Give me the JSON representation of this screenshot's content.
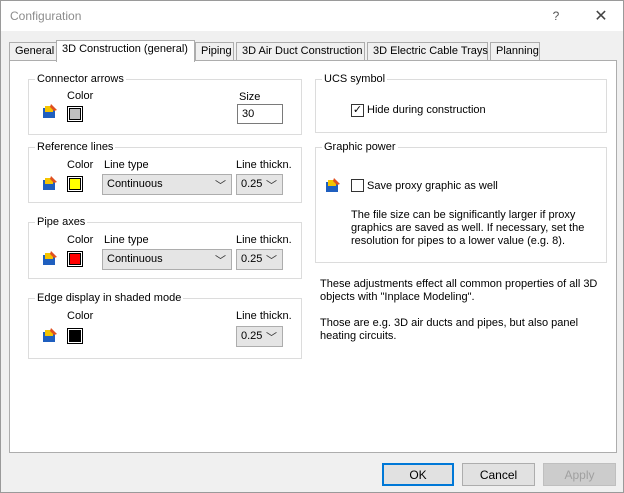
{
  "window": {
    "title": "Configuration",
    "help_glyph": "?",
    "close_glyph": "✕"
  },
  "tabs": [
    "General",
    "3D Construction (general)",
    "Piping",
    "3D Air Duct Construction",
    "3D Electric Cable Trays",
    "Planning"
  ],
  "active_tab": "3D Construction (general)",
  "connector_arrows": {
    "title": "Connector arrows",
    "color_label": "Color",
    "color": "#c0c0c0",
    "size_label": "Size",
    "size_value": "30"
  },
  "reference_lines": {
    "title": "Reference lines",
    "color_label": "Color",
    "color": "#ffff00",
    "linetype_label": "Line type",
    "linetype_value": "Continuous",
    "thickness_label": "Line thickn.",
    "thickness_value": "0.25"
  },
  "pipe_axes": {
    "title": "Pipe axes",
    "color_label": "Color",
    "color": "#ff0000",
    "linetype_label": "Line type",
    "linetype_value": "Continuous",
    "thickness_label": "Line thickn.",
    "thickness_value": "0.25"
  },
  "edge_display": {
    "title": "Edge display in shaded mode",
    "color_label": "Color",
    "color": "#000000",
    "thickness_label": "Line thickn.",
    "thickness_value": "0.25"
  },
  "ucs_symbol": {
    "title": "UCS symbol",
    "hide_label": "Hide during construction",
    "hide_checked": true
  },
  "graphic_power": {
    "title": "Graphic power",
    "proxy_label": "Save proxy graphic as well",
    "proxy_checked": false,
    "note_lines": [
      "The file size can be significantly larger if proxy",
      "graphics are saved as well. If necessary, set the",
      "resolution for pipes to a lower value (e.g. 8)."
    ]
  },
  "info": {
    "lines1": [
      "These adjustments effect all common properties of all 3D",
      "objects with \"Inplace Modeling\"."
    ],
    "lines2": [
      "Those are e.g. 3D air ducts and pipes, but also panel",
      "heating circuits."
    ]
  },
  "buttons": {
    "ok": "OK",
    "cancel": "Cancel",
    "apply": "Apply"
  },
  "icons": {
    "color_picker": "color-picker-icon",
    "chevron": "chevron-down-icon"
  }
}
